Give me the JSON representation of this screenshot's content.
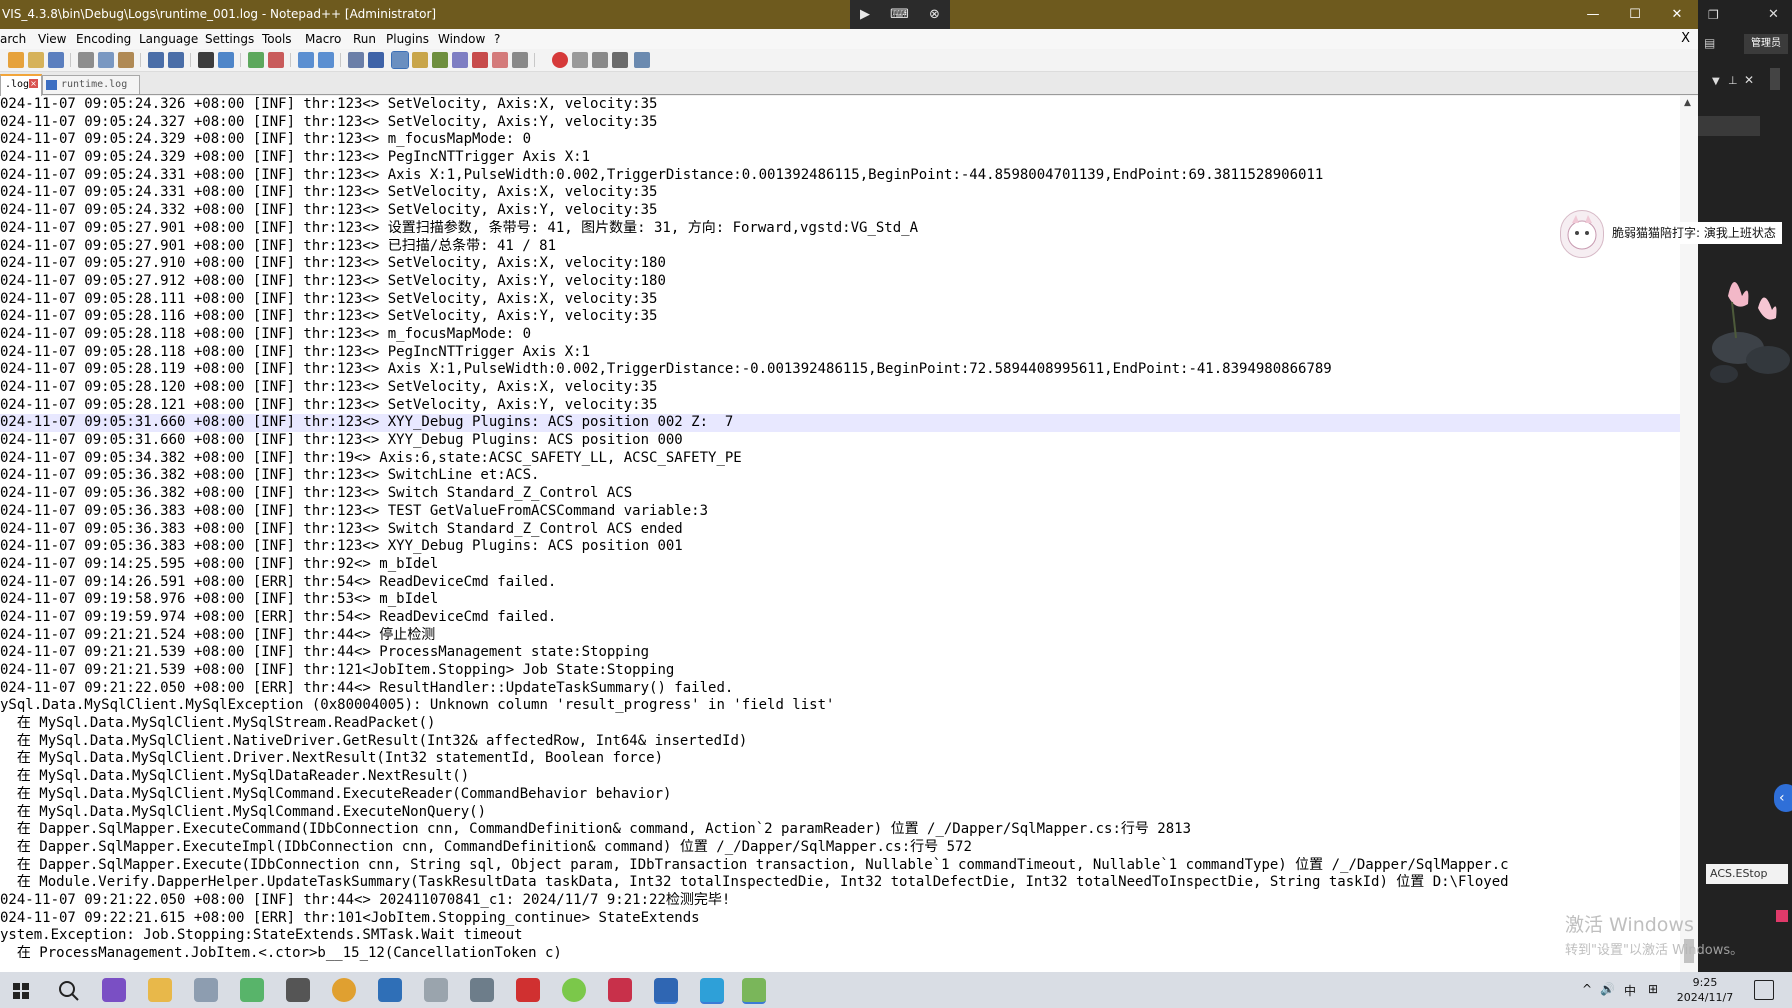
{
  "window": {
    "title": "VIS_4.3.8\\bin\\Debug\\Logs\\runtime_001.log - Notepad++ [Administrator]",
    "remote_controls": [
      "▶",
      "⌨",
      "⊗"
    ],
    "controls": {
      "minimize": "—",
      "maximize": "☐",
      "close": "✕"
    }
  },
  "menu": {
    "items": [
      "arch",
      "View",
      "Encoding",
      "Language",
      "Settings",
      "Tools",
      "Macro",
      "Run",
      "Plugins",
      "Window",
      "?"
    ],
    "close": "X"
  },
  "tabs": [
    {
      "label": ".log",
      "active": true
    },
    {
      "label": "runtime.log",
      "active": false
    }
  ],
  "editor": {
    "lines": [
      "024-11-07 09:05:24.326 +08:00 [INF] thr:123<> SetVelocity, Axis:X, velocity:35",
      "024-11-07 09:05:24.327 +08:00 [INF] thr:123<> SetVelocity, Axis:Y, velocity:35",
      "024-11-07 09:05:24.329 +08:00 [INF] thr:123<> m_focusMapMode: 0",
      "024-11-07 09:05:24.329 +08:00 [INF] thr:123<> PegIncNTTrigger Axis X:1",
      "024-11-07 09:05:24.331 +08:00 [INF] thr:123<> Axis X:1,PulseWidth:0.002,TriggerDistance:0.001392486115,BeginPoint:-44.8598004701139,EndPoint:69.3811528906011",
      "024-11-07 09:05:24.331 +08:00 [INF] thr:123<> SetVelocity, Axis:X, velocity:35",
      "024-11-07 09:05:24.332 +08:00 [INF] thr:123<> SetVelocity, Axis:Y, velocity:35",
      "024-11-07 09:05:27.901 +08:00 [INF] thr:123<> 设置扫描参数, 条带号: 41, 图片数量: 31, 方向: Forward,vgstd:VG_Std_A",
      "024-11-07 09:05:27.901 +08:00 [INF] thr:123<> 已扫描/总条带: 41 / 81",
      "024-11-07 09:05:27.910 +08:00 [INF] thr:123<> SetVelocity, Axis:X, velocity:180",
      "024-11-07 09:05:27.912 +08:00 [INF] thr:123<> SetVelocity, Axis:Y, velocity:180",
      "024-11-07 09:05:28.111 +08:00 [INF] thr:123<> SetVelocity, Axis:X, velocity:35",
      "024-11-07 09:05:28.116 +08:00 [INF] thr:123<> SetVelocity, Axis:Y, velocity:35",
      "024-11-07 09:05:28.118 +08:00 [INF] thr:123<> m_focusMapMode: 0",
      "024-11-07 09:05:28.118 +08:00 [INF] thr:123<> PegIncNTTrigger Axis X:1",
      "024-11-07 09:05:28.119 +08:00 [INF] thr:123<> Axis X:1,PulseWidth:0.002,TriggerDistance:-0.001392486115,BeginPoint:72.5894408995611,EndPoint:-41.8394980866789",
      "024-11-07 09:05:28.120 +08:00 [INF] thr:123<> SetVelocity, Axis:X, velocity:35",
      "024-11-07 09:05:28.121 +08:00 [INF] thr:123<> SetVelocity, Axis:Y, velocity:35",
      "024-11-07 09:05:31.660 +08:00 [INF] thr:123<> XYY_Debug Plugins: ACS position 002 Z:  7",
      "024-11-07 09:05:31.660 +08:00 [INF] thr:123<> XYY_Debug Plugins: ACS position 000",
      "024-11-07 09:05:34.382 +08:00 [INF] thr:19<> Axis:6,state:ACSC_SAFETY_LL, ACSC_SAFETY_PE",
      "024-11-07 09:05:36.382 +08:00 [INF] thr:123<> SwitchLine et:ACS.",
      "024-11-07 09:05:36.382 +08:00 [INF] thr:123<> Switch Standard_Z_Control ACS",
      "024-11-07 09:05:36.383 +08:00 [INF] thr:123<> TEST GetValueFromACSCommand variable:3",
      "024-11-07 09:05:36.383 +08:00 [INF] thr:123<> Switch Standard_Z_Control ACS ended",
      "024-11-07 09:05:36.383 +08:00 [INF] thr:123<> XYY_Debug Plugins: ACS position 001",
      "024-11-07 09:14:25.595 +08:00 [INF] thr:92<> m_bIdel",
      "024-11-07 09:14:26.591 +08:00 [ERR] thr:54<> ReadDeviceCmd failed.",
      "024-11-07 09:19:58.976 +08:00 [INF] thr:53<> m_bIdel",
      "024-11-07 09:19:59.974 +08:00 [ERR] thr:54<> ReadDeviceCmd failed.",
      "024-11-07 09:21:21.524 +08:00 [INF] thr:44<> 停止检测",
      "024-11-07 09:21:21.539 +08:00 [INF] thr:44<> ProcessManagement state:Stopping",
      "024-11-07 09:21:21.539 +08:00 [INF] thr:121<JobItem.Stopping> Job State:Stopping",
      "024-11-07 09:21:22.050 +08:00 [ERR] thr:44<> ResultHandler::UpdateTaskSummary() failed.",
      "ySql.Data.MySqlClient.MySqlException (0x80004005): Unknown column 'result_progress' in 'field list'",
      "  在 MySql.Data.MySqlClient.MySqlStream.ReadPacket()",
      "  在 MySql.Data.MySqlClient.NativeDriver.GetResult(Int32& affectedRow, Int64& insertedId)",
      "  在 MySql.Data.MySqlClient.Driver.NextResult(Int32 statementId, Boolean force)",
      "  在 MySql.Data.MySqlClient.MySqlDataReader.NextResult()",
      "  在 MySql.Data.MySqlClient.MySqlCommand.ExecuteReader(CommandBehavior behavior)",
      "  在 MySql.Data.MySqlClient.MySqlCommand.ExecuteNonQuery()",
      "  在 Dapper.SqlMapper.ExecuteCommand(IDbConnection cnn, CommandDefinition& command, Action`2 paramReader) 位置 /_/Dapper/SqlMapper.cs:行号 2813",
      "  在 Dapper.SqlMapper.ExecuteImpl(IDbConnection cnn, CommandDefinition& command) 位置 /_/Dapper/SqlMapper.cs:行号 572",
      "  在 Dapper.SqlMapper.Execute(IDbConnection cnn, String sql, Object param, IDbTransaction transaction, Nullable`1 commandTimeout, Nullable`1 commandType) 位置 /_/Dapper/SqlMapper.c",
      "  在 Module.Verify.DapperHelper.UpdateTaskSummary(TaskResultData taskData, Int32 totalInspectedDie, Int32 totalDefectDie, Int32 totalNeedToInspectDie, String taskId) 位置 D:\\Floyed",
      "024-11-07 09:21:22.050 +08:00 [INF] thr:44<> 202411070841_c1: 2024/11/7 9:21:22检测完毕!",
      "024-11-07 09:22:21.615 +08:00 [ERR] thr:101<JobItem.Stopping_continue> StateExtends",
      "ystem.Exception: Job.Stopping:StateExtends.SMTask.Wait timeout",
      "  在 ProcessManagement.JobItem.<.ctor>b__15_12(CancellationToken c)"
    ],
    "highlighted_line_index": 18
  },
  "side": {
    "admin_label": "管理员",
    "estop_label": "ACS.EStop",
    "expand_glyph": "‹"
  },
  "overlay": {
    "cat_text": "脆弱猫猫陪打字: 演我上班状态",
    "activation_title": "激活 Windows",
    "activation_sub": "转到\"设置\"以激活 Windows。"
  },
  "taskbar": {
    "tray_caret": "^",
    "tray_volume": "🔊",
    "tray_ime": "中",
    "tray_keyboard": "⊞",
    "time": "9:25",
    "date": "2024/11/7"
  },
  "colors": {
    "titlebar": "#6e5a1e",
    "tab_accent": "#f2a53a",
    "highlight_line": "#e8e8ff",
    "taskbar": "#d9dde4"
  }
}
